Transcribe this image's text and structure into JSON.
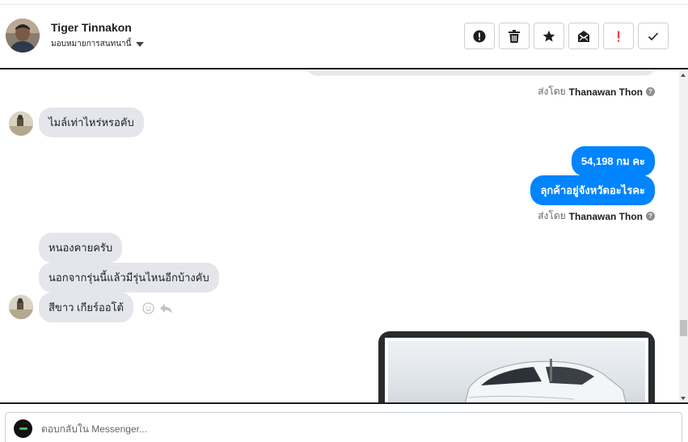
{
  "header": {
    "contact_name": "Tiger Tinnakon",
    "assign_label": "มอบหมายการสนทนานี้",
    "actions": [
      {
        "name": "report-button",
        "icon": "alert-circle-icon"
      },
      {
        "name": "delete-button",
        "icon": "trash-icon"
      },
      {
        "name": "star-button",
        "icon": "star-icon"
      },
      {
        "name": "mark-unread-button",
        "icon": "envelope-icon"
      },
      {
        "name": "follow-up-button",
        "icon": "exclamation-icon",
        "color": "#fa383e"
      },
      {
        "name": "mark-done-button",
        "icon": "check-icon"
      }
    ]
  },
  "messages": {
    "sent_by_prefix": "ส่งโดย",
    "agent_name": "Thanawan Thon",
    "incoming_1": "ไมล์เท่าไหร่หรอคับ",
    "outgoing_1": "54,198 กม คะ",
    "outgoing_2": "ลุกค้าอยู่จังหวัดอะไรคะ",
    "incoming_2": "หนองคายครับ",
    "incoming_3": "นอกจากรุ่นนี้แล้วมีรุ่นไหนอีกบ้างคับ",
    "incoming_4": "สีขาว เกียร์ออโต้"
  },
  "composer": {
    "placeholder": "ตอบกลับใน Messenger..."
  },
  "colors": {
    "outgoing_bubble": "#0084ff",
    "incoming_bubble": "#e4e6eb"
  }
}
